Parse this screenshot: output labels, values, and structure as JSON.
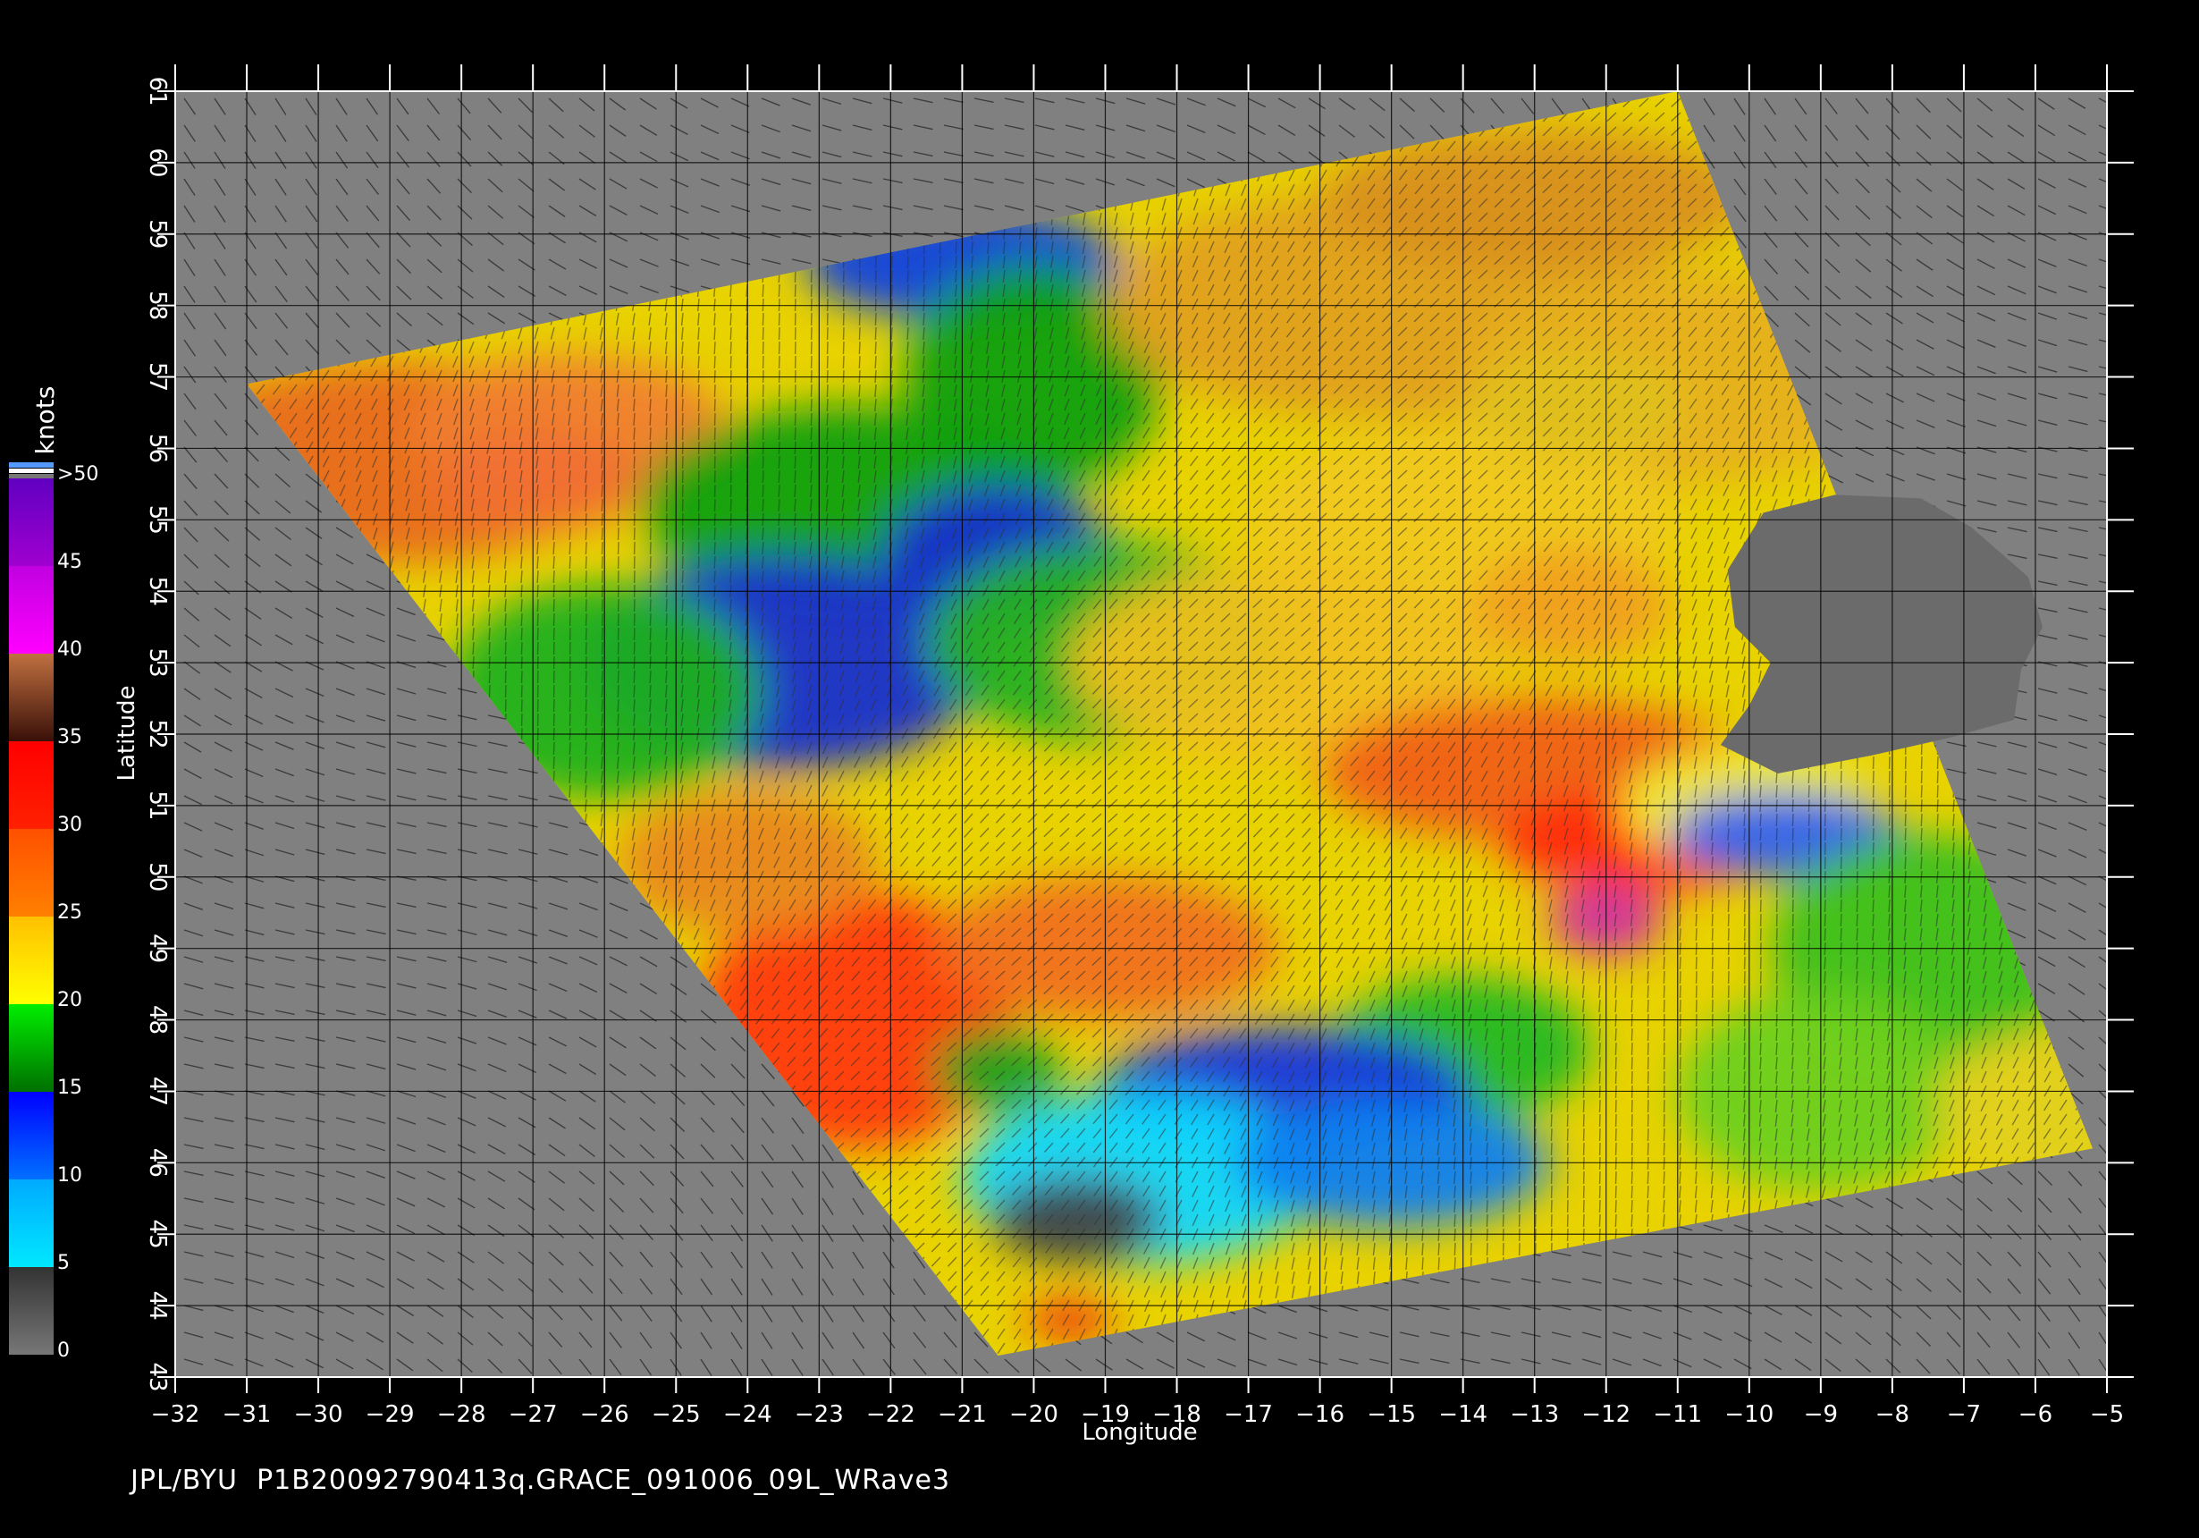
{
  "map": {
    "xlabel": "Longitude",
    "ylabel": "Latitude",
    "x_ticks": [
      -32,
      -31,
      -30,
      -29,
      -28,
      -27,
      -26,
      -25,
      -24,
      -23,
      -22,
      -21,
      -20,
      -19,
      -18,
      -17,
      -16,
      -15,
      -14,
      -13,
      -12,
      -11,
      -10,
      -9,
      -8,
      -7,
      -6,
      -5
    ],
    "y_ticks": [
      43,
      44,
      45,
      46,
      47,
      48,
      49,
      50,
      51,
      52,
      53,
      54,
      55,
      56,
      57,
      58,
      59,
      60,
      61
    ],
    "xlim": [
      -32,
      -5
    ],
    "ylim": [
      43,
      61
    ],
    "grid": true,
    "land_color": "#6b6b6b",
    "background_color": "#808080",
    "swath_corners_lonlat": [
      [
        -31,
        56.9
      ],
      [
        -11,
        61
      ],
      [
        -5.2,
        46.2
      ],
      [
        -20.5,
        43.3
      ]
    ],
    "wind_features": [
      {
        "name": "storm-center",
        "lon": -12,
        "lat": 49.4,
        "speed_knots": 42
      },
      {
        "name": "calm-zone",
        "lon": -19.5,
        "lat": 45.5,
        "speed_knots": 5
      }
    ]
  },
  "colorbar": {
    "unit_label": "knots",
    "tick_labels": [
      ">50",
      "45",
      "40",
      "35",
      "30",
      "25",
      "20",
      "15",
      "10",
      "5",
      "0"
    ],
    "bands": [
      {
        "from": 0,
        "to": 5,
        "colors": [
          "#777777",
          "#333333"
        ]
      },
      {
        "from": 5,
        "to": 10,
        "colors": [
          "#00e8ff",
          "#00aaff"
        ]
      },
      {
        "from": 10,
        "to": 15,
        "colors": [
          "#0070ff",
          "#0000ff"
        ]
      },
      {
        "from": 15,
        "to": 20,
        "colors": [
          "#007000",
          "#00ee00"
        ]
      },
      {
        "from": 20,
        "to": 25,
        "colors": [
          "#ffff00",
          "#ffc000"
        ]
      },
      {
        "from": 25,
        "to": 30,
        "colors": [
          "#ff8000",
          "#ff5000"
        ]
      },
      {
        "from": 30,
        "to": 35,
        "colors": [
          "#ff2000",
          "#ff0000"
        ]
      },
      {
        "from": 35,
        "to": 40,
        "colors": [
          "#3a1008",
          "#c07040"
        ]
      },
      {
        "from": 40,
        "to": 45,
        "colors": [
          "#ff00ff",
          "#c000e0"
        ]
      },
      {
        "from": 45,
        "to": 50,
        "colors": [
          "#a000d0",
          "#6000c0"
        ]
      }
    ]
  },
  "footer": {
    "source": "JPL/BYU",
    "filename": "P1B20092790413q.GRACE_091006_09L_WRave3"
  }
}
